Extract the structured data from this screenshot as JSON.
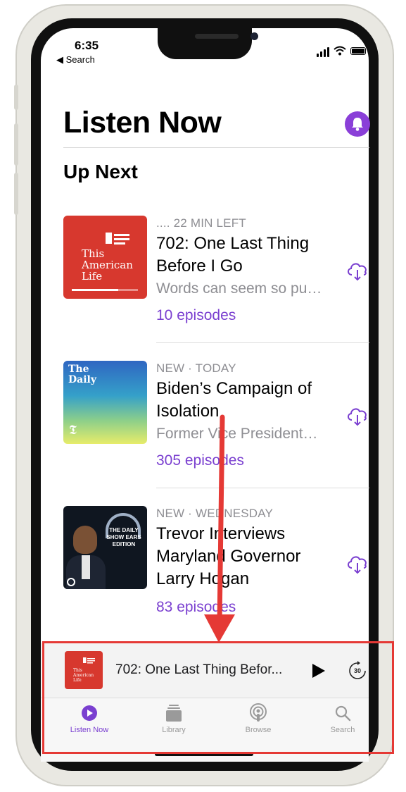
{
  "status_bar": {
    "time": "6:35",
    "back_label": "◀ Search"
  },
  "header": {
    "title": "Listen Now"
  },
  "section": {
    "title": "Up Next"
  },
  "episodes": [
    {
      "meta": ".... 22 MIN LEFT",
      "title": "702: One Last Thing Before I Go",
      "description": "Words can seem so pu…",
      "count": "10 episodes",
      "art_text": "This American Life"
    },
    {
      "meta": "NEW · TODAY",
      "title": "Biden’s Campaign of Isolation",
      "description": "Former Vice President…",
      "count": "305 episodes",
      "art_text": "The Daily"
    },
    {
      "meta": "NEW · WEDNESDAY",
      "title": "Trevor Interviews Maryland Governor Larry Hogan",
      "description": "",
      "count": "83 episodes",
      "art_text": "THE DAILY SHOW EARS EDITION"
    }
  ],
  "mini_player": {
    "title": "702: One Last Thing Befor...",
    "skip_label": "30",
    "art_text": "This American Life"
  },
  "tabs": [
    {
      "label": "Listen Now",
      "active": true
    },
    {
      "label": "Library",
      "active": false
    },
    {
      "label": "Browse",
      "active": false
    },
    {
      "label": "Search",
      "active": false
    }
  ],
  "colors": {
    "accent": "#7a3fd0",
    "tal_red": "#d7382e",
    "annotation_red": "#e53935"
  }
}
